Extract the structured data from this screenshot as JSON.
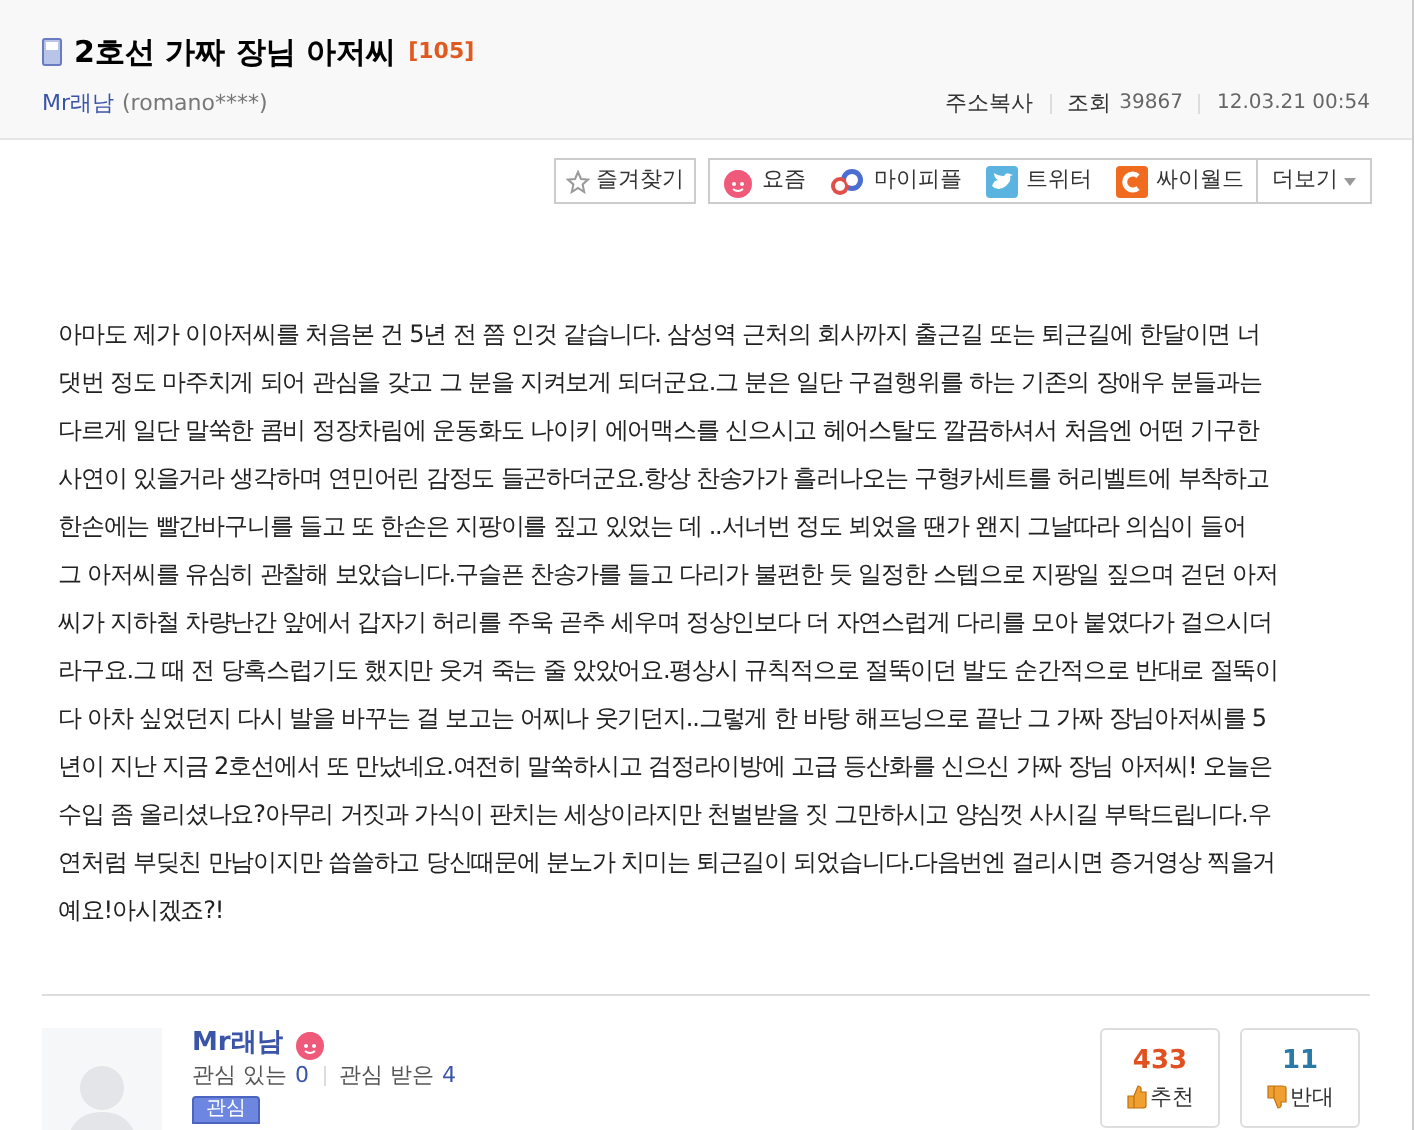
{
  "post": {
    "title": "2호선 가짜 장님 아저씨",
    "comment_count": "[105]",
    "author": "Mr래남",
    "author_id": "(romano****)",
    "copy_link": "주소복사",
    "views_label": "조회",
    "views": "39867",
    "date": "12.03.21 00:54"
  },
  "share": {
    "favorite": "즐겨찾기",
    "services": [
      {
        "kind": "yozm",
        "label": "요즘"
      },
      {
        "kind": "mypeople",
        "label": "마이피플"
      },
      {
        "kind": "twitter",
        "label": "트위터"
      },
      {
        "kind": "cyworld",
        "label": "싸이월드"
      }
    ],
    "more": "더보기"
  },
  "body_lines": [
    "아마도 제가 이아저씨를 처음본 건 5년 전 쯤 인것 같습니다. 삼성역 근처의 회사까지 출근길 또는 퇴근길에 한달이면 너",
    "댓번 정도 마주치게 되어 관심을 갖고 그 분을 지켜보게 되더군요.그 분은 일단 구걸행위를 하는 기존의 장애우 분들과는",
    "다르게 일단 말쑥한 콤비 정장차림에 운동화도 나이키 에어맥스를 신으시고 헤어스탈도 깔끔하셔서 처음엔 어떤 기구한",
    "사연이 있을거라 생각하며 연민어린 감정도 들곤하더군요.항상 찬송가가 흘러나오는 구형카세트를 허리벨트에 부착하고",
    "한손에는 빨간바구니를 들고 또 한손은 지팡이를 짚고 있었는 데 ..서너번 정도 뵈었을 땐가 왠지 그날따라 의심이 들어",
    "그 아저씨를 유심히 관찰해 보았습니다.구슬픈 찬송가를 들고 다리가 불편한 듯 일정한 스텝으로 지팡일 짚으며 걷던 아저",
    "씨가 지하철 차량난간 앞에서 갑자기 허리를 주욱 곧추 세우며 정상인보다 더 자연스럽게 다리를 모아 붙였다가 걸으시더",
    "라구요.그 때 전 당혹스럽기도 했지만 웃겨 죽는 줄 았았어요.평상시 규칙적으로 절뚝이던 발도 순간적으로 반대로 절뚝이",
    "다 아차 싶었던지 다시 발을 바꾸는 걸 보고는 어찌나 웃기던지..그렇게 한 바탕 해프닝으로 끝난 그 가짜 장님아저씨를 5",
    "년이 지난 지금 2호선에서 또 만났네요.여전히 말쑥하시고 검정라이방에 고급 등산화를 신으신 가짜 장님 아저씨! 오늘은",
    "수입 좀 올리셨나요?아무리 거짓과 가식이 판치는 세상이라지만 천벌받을 짓 그만하시고 양심껏 사시길 부탁드립니다.우",
    "연처럼 부딪친 만남이지만 씁쓸하고 당신때문에 분노가 치미는 퇴근길이 되었습니다.다음번엔 걸리시면 증거영상 찍을거",
    "예요!아시겠죠?!"
  ],
  "profile": {
    "name": "Mr래남",
    "interest_in_label": "관심 있는",
    "interest_in": "0",
    "interest_from_label": "관심 받은",
    "interest_from": "4",
    "follow_button": "관심"
  },
  "votes": [
    {
      "kind": "up",
      "count": "433",
      "label": "추천"
    },
    {
      "kind": "down",
      "count": "11",
      "label": "반대"
    }
  ]
}
